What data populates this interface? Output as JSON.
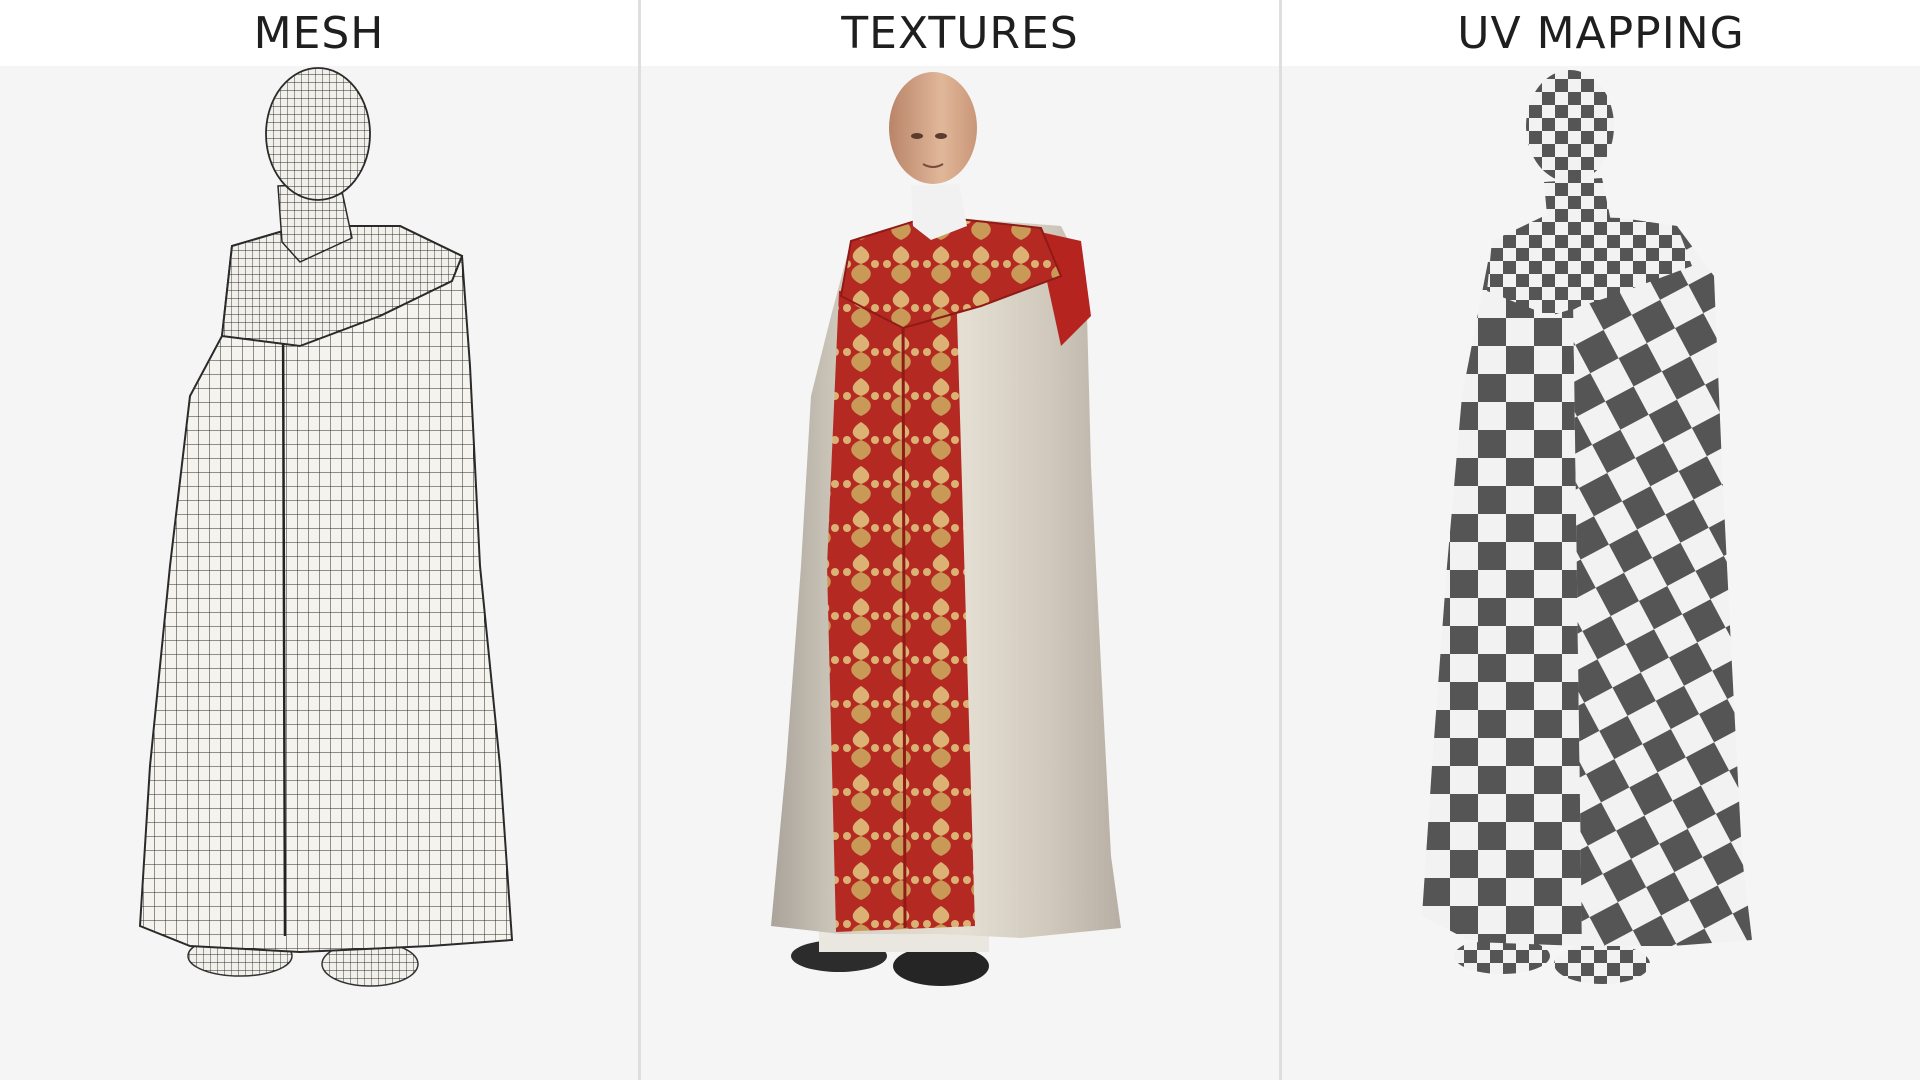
{
  "panels": [
    {
      "id": "mesh",
      "title": "MESH",
      "render_style": "wireframe"
    },
    {
      "id": "textures",
      "title": "TEXTURES",
      "render_style": "textured"
    },
    {
      "id": "uv",
      "title": "UV MAPPING",
      "render_style": "checker"
    }
  ],
  "colors": {
    "header_bg": "#ffffff",
    "panel_bg": "#f5f5f6",
    "divider": "#dedede",
    "cape_cream": "#ddd6cb",
    "orphrey_red": "#b5241f",
    "gold": "#d8ae6b",
    "checker_dark": "#555555",
    "checker_light": "#f2f2f2"
  }
}
